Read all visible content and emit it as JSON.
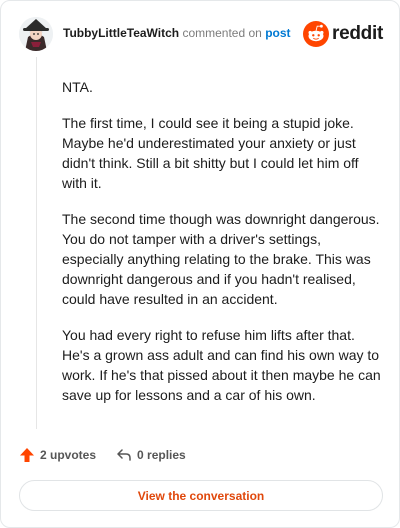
{
  "header": {
    "username": "TubbyLittleTeaWitch",
    "action_text": "commented on",
    "post_link": "post",
    "brand": "reddit"
  },
  "comment": {
    "paragraphs": [
      "NTA.",
      "The first time, I could see it being a stupid joke. Maybe he'd underestimated your anxiety or just didn't think. Still a bit shitty but I could let him off with it.",
      "The second time though was downright dangerous. You do not tamper with a driver's settings, especially anything relating to the brake. This was downright dangerous and if you hadn't realised, could have resulted in an accident.",
      "You had every right to refuse him lifts after that. He's a grown ass adult and can find his own way to work. If he's that pissed about it then maybe he can save up for lessons and a car of his own."
    ]
  },
  "actions": {
    "upvotes": "2 upvotes",
    "replies": "0 replies"
  },
  "footer": {
    "button_label": "View the conversation"
  },
  "colors": {
    "accent": "#ff4500",
    "link": "#0079d3",
    "button_text": "#e0480c"
  }
}
